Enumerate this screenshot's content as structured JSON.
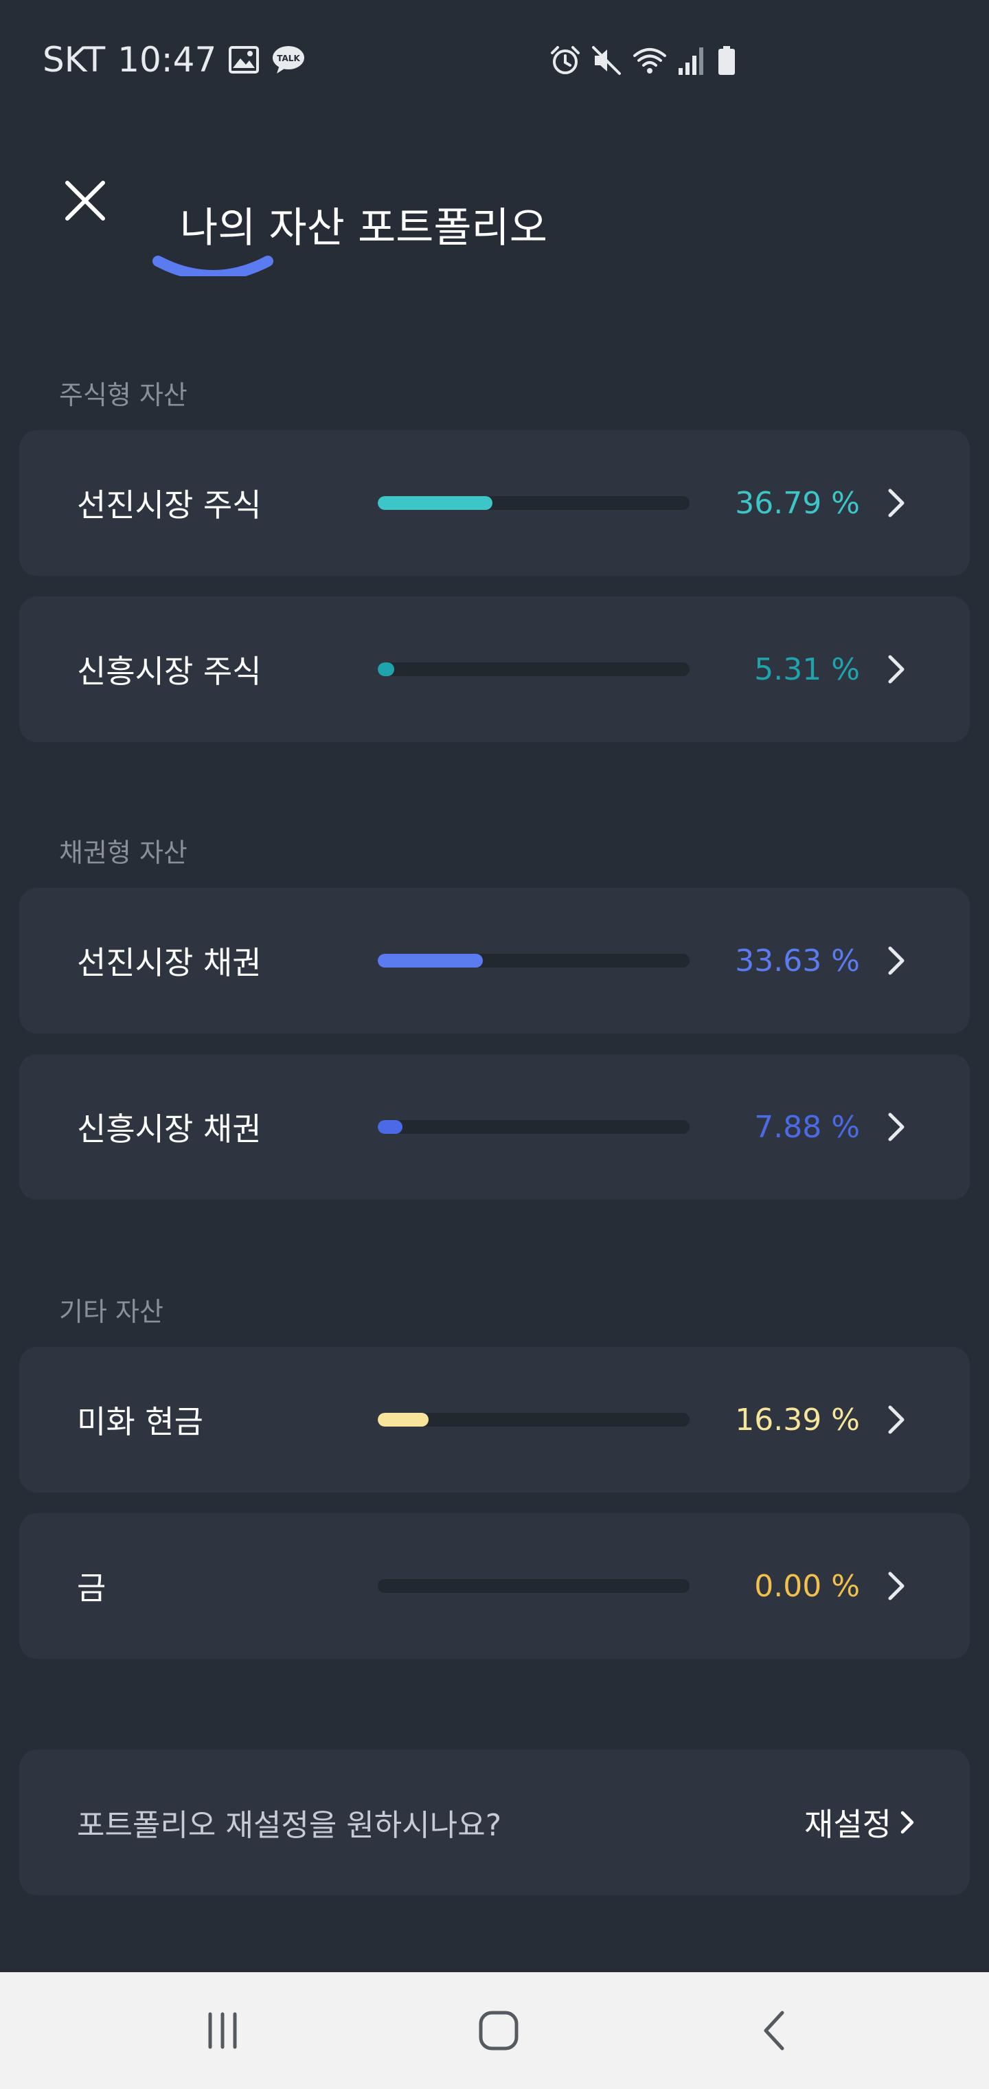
{
  "status_bar": {
    "carrier": "SKT",
    "time": "10:47",
    "icons": [
      "gallery-icon",
      "talk-icon",
      "alarm-icon",
      "mute-icon",
      "wifi-icon",
      "signal-icon",
      "battery-icon"
    ],
    "talk_badge": "TALK"
  },
  "header": {
    "title": "나의 자산 포트폴리오",
    "close_icon": "close-icon"
  },
  "colors": {
    "background": "#272d37",
    "card": "#2f3540",
    "track": "#222830",
    "teal_light": "#3cc6c8",
    "teal_dark": "#1fa3ad",
    "blue_light": "#5a7cf0",
    "blue_dark": "#4a6ae6",
    "yellow": "#f6e59a",
    "gold": "#f1c14b",
    "chart_arc": "#5a7cf0"
  },
  "sections": [
    {
      "label": "주식형 자산",
      "items": [
        {
          "name": "선진시장 주식",
          "percent_text": "36.79 %",
          "fraction": 0.3679,
          "color": "#3cc6c8"
        },
        {
          "name": "신흥시장 주식",
          "percent_text": "5.31 %",
          "fraction": 0.0531,
          "color": "#1fa3ad"
        }
      ]
    },
    {
      "label": "채권형 자산",
      "items": [
        {
          "name": "선진시장 채권",
          "percent_text": "33.63 %",
          "fraction": 0.3363,
          "color": "#5a7cf0"
        },
        {
          "name": "신흥시장 채권",
          "percent_text": "7.88 %",
          "fraction": 0.0788,
          "color": "#4a6ae6"
        }
      ]
    },
    {
      "label": "기타 자산",
      "items": [
        {
          "name": "미화 현금",
          "percent_text": "16.39 %",
          "fraction": 0.1639,
          "color": "#f6e59a"
        },
        {
          "name": "금",
          "percent_text": "0.00 %",
          "fraction": 0.0,
          "color": "#f1c14b"
        }
      ]
    }
  ],
  "reset": {
    "question": "포트폴리오 재설정을 원하시나요?",
    "link_label": "재설정"
  },
  "nav_bar": {
    "icons": [
      "recent-apps-icon",
      "home-icon",
      "back-icon"
    ]
  }
}
